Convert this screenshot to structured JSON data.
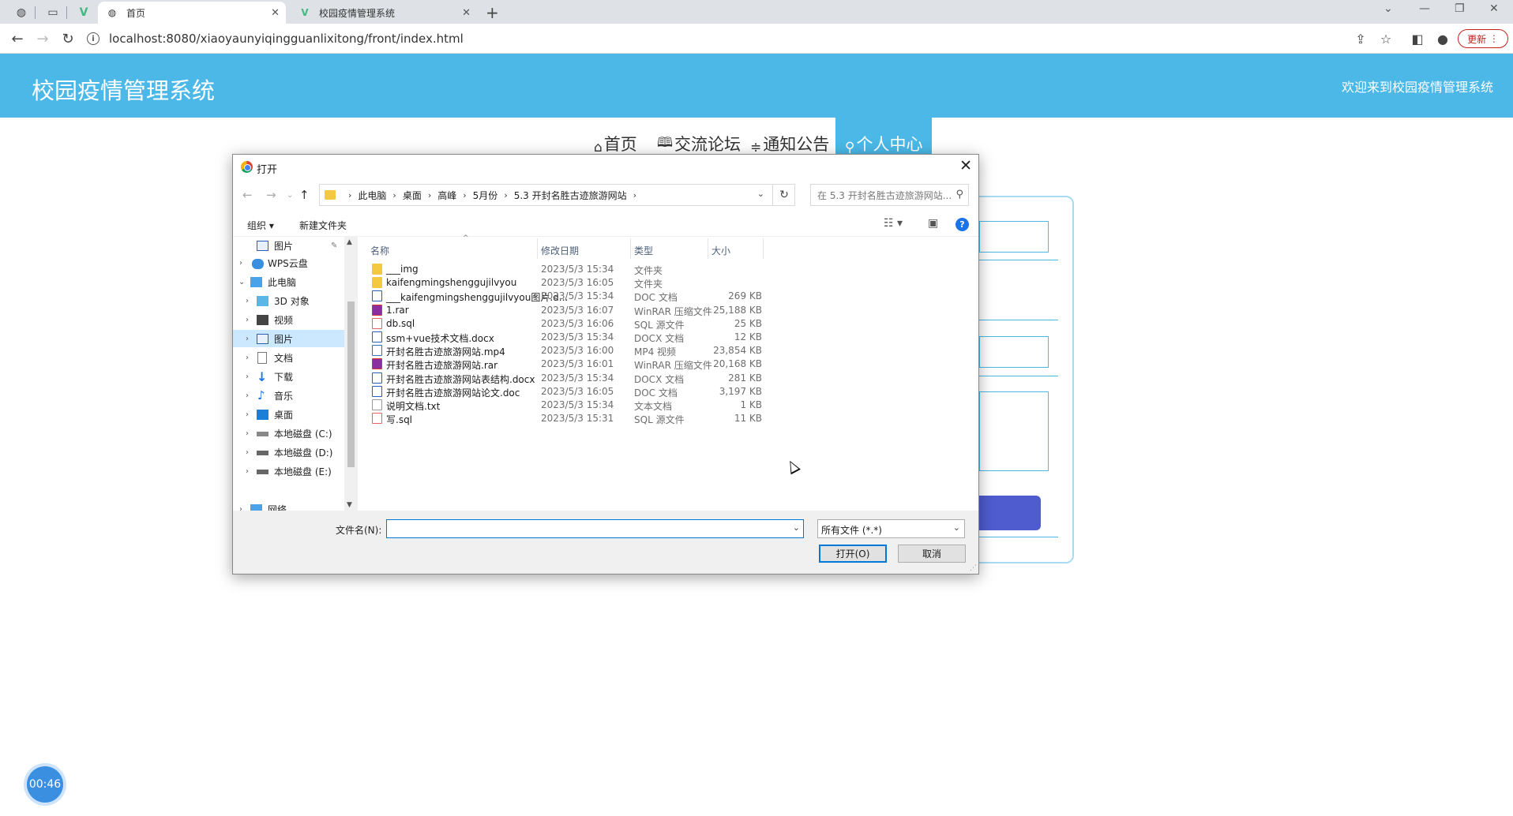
{
  "browser": {
    "tabs": [
      {
        "title": "首页",
        "active": true
      },
      {
        "title": "校园疫情管理系统",
        "active": false
      }
    ],
    "url": "localhost:8080/xiaoyaunyiqingguanlixitong/front/index.html",
    "update_label": "更新"
  },
  "site": {
    "title": "校园疫情管理系统",
    "welcome": "欢迎来到校园疫情管理系统",
    "nav": [
      {
        "icon": "⌂",
        "label": "首页"
      },
      {
        "icon": "🕮",
        "label": "交流论坛"
      },
      {
        "icon": "≑",
        "label": "通知公告"
      },
      {
        "icon": "⚲",
        "label": "个人中心"
      }
    ],
    "timer": "00:46",
    "accent_color": "#4bb8e7"
  },
  "dialog": {
    "title": "打开",
    "breadcrumb": [
      "此电脑",
      "桌面",
      "高峰",
      "5月份",
      "5.3 开封名胜古迹旅游网站"
    ],
    "search_placeholder": "在 5.3 开封名胜古迹旅游网站...",
    "toolbar": {
      "organize": "组织 ▾",
      "new_folder": "新建文件夹"
    },
    "nav_pane": [
      {
        "label": "图片",
        "icon": "pictures-icon",
        "pinned": true
      },
      {
        "label": "WPS云盘",
        "icon": "cloud-icon"
      },
      {
        "label": "此电脑",
        "icon": "computer-icon"
      },
      {
        "label": "3D 对象",
        "icon": "3d-objects-icon"
      },
      {
        "label": "视频",
        "icon": "video-icon"
      },
      {
        "label": "图片",
        "icon": "pictures-icon",
        "selected": true
      },
      {
        "label": "文档",
        "icon": "documents-icon"
      },
      {
        "label": "下载",
        "icon": "download-icon"
      },
      {
        "label": "音乐",
        "icon": "music-icon"
      },
      {
        "label": "桌面",
        "icon": "desktop-icon"
      },
      {
        "label": "本地磁盘 (C:)",
        "icon": "drive-icon"
      },
      {
        "label": "本地磁盘 (D:)",
        "icon": "drive-icon"
      },
      {
        "label": "本地磁盘 (E:)",
        "icon": "drive-icon"
      },
      {
        "label": "网络",
        "icon": "network-icon"
      }
    ],
    "columns": [
      "名称",
      "修改日期",
      "类型",
      "大小"
    ],
    "files": [
      {
        "name": "___img",
        "date": "2023/5/3 15:34",
        "type": "文件夹",
        "size": "",
        "icon": "folder"
      },
      {
        "name": "kaifengmingshenggujilvyou",
        "date": "2023/5/3 16:05",
        "type": "文件夹",
        "size": "",
        "icon": "folder"
      },
      {
        "name": "___kaifengmingshenggujilvyou图片.d...",
        "date": "2023/5/3 15:34",
        "type": "DOC 文档",
        "size": "269 KB",
        "icon": "doc"
      },
      {
        "name": "1.rar",
        "date": "2023/5/3 16:07",
        "type": "WinRAR 压缩文件",
        "size": "25,188 KB",
        "icon": "rar"
      },
      {
        "name": "db.sql",
        "date": "2023/5/3 16:06",
        "type": "SQL 源文件",
        "size": "25 KB",
        "icon": "sql"
      },
      {
        "name": "ssm+vue技术文档.docx",
        "date": "2023/5/3 15:34",
        "type": "DOCX 文档",
        "size": "12 KB",
        "icon": "doc"
      },
      {
        "name": "开封名胜古迹旅游网站.mp4",
        "date": "2023/5/3 16:00",
        "type": "MP4 视频",
        "size": "23,854 KB",
        "icon": "mp4"
      },
      {
        "name": "开封名胜古迹旅游网站.rar",
        "date": "2023/5/3 16:01",
        "type": "WinRAR 压缩文件",
        "size": "20,168 KB",
        "icon": "rar"
      },
      {
        "name": "开封名胜古迹旅游网站表结构.docx",
        "date": "2023/5/3 15:34",
        "type": "DOCX 文档",
        "size": "281 KB",
        "icon": "doc"
      },
      {
        "name": "开封名胜古迹旅游网站论文.doc",
        "date": "2023/5/3 16:05",
        "type": "DOC 文档",
        "size": "3,197 KB",
        "icon": "doc"
      },
      {
        "name": "说明文档.txt",
        "date": "2023/5/3 15:34",
        "type": "文本文档",
        "size": "1 KB",
        "icon": "txt"
      },
      {
        "name": "写.sql",
        "date": "2023/5/3 15:31",
        "type": "SQL 源文件",
        "size": "11 KB",
        "icon": "sql"
      }
    ],
    "filename_label": "文件名(N):",
    "filename_value": "",
    "filetype": "所有文件 (*.*)",
    "open_label": "打开(O)",
    "cancel_label": "取消"
  }
}
